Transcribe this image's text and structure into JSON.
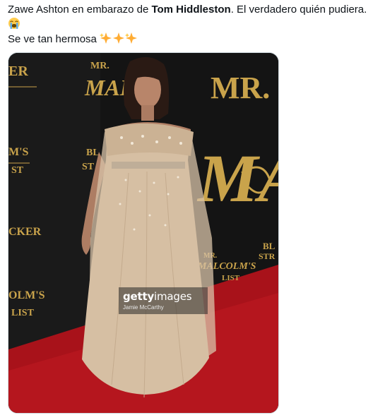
{
  "tweet": {
    "line1_pre": "Zawe Ashton en embarazo de ",
    "line1_bold": "Tom Hiddleston",
    "line1_post": ". El verdadero quién pudiera.",
    "line2_emoji": "loudly-crying-face-icon",
    "line3_text": "Se ve tan hermosa",
    "line3_emoji": "sparkles-icon"
  },
  "media": {
    "watermark_logo_bold": "getty",
    "watermark_logo_rest": "images",
    "watermark_credit": "Jamie McCarthy",
    "backdrop_texts": {
      "left_top": "ER",
      "left_mid": "M'S",
      "left_mid2": "ST",
      "left_low": "CKER",
      "left_bottom1": "OLM'S",
      "left_bottom2": "LIST",
      "center_mr": "MR.",
      "center_malc": "MALC",
      "center_bl": "BL",
      "center_st": "ST",
      "right_mr": "MR.",
      "right_ma": "MA",
      "right_bl": "BL",
      "right_str": "STR",
      "lower_mr": "MR.",
      "lower_malcolms": "MALCOLM'S",
      "lower_list": "LIST"
    }
  },
  "colors": {
    "backdrop": "#141414",
    "gold": "#c9a34b",
    "carpet": "#b3141b",
    "dress": "#d8c3a8"
  }
}
